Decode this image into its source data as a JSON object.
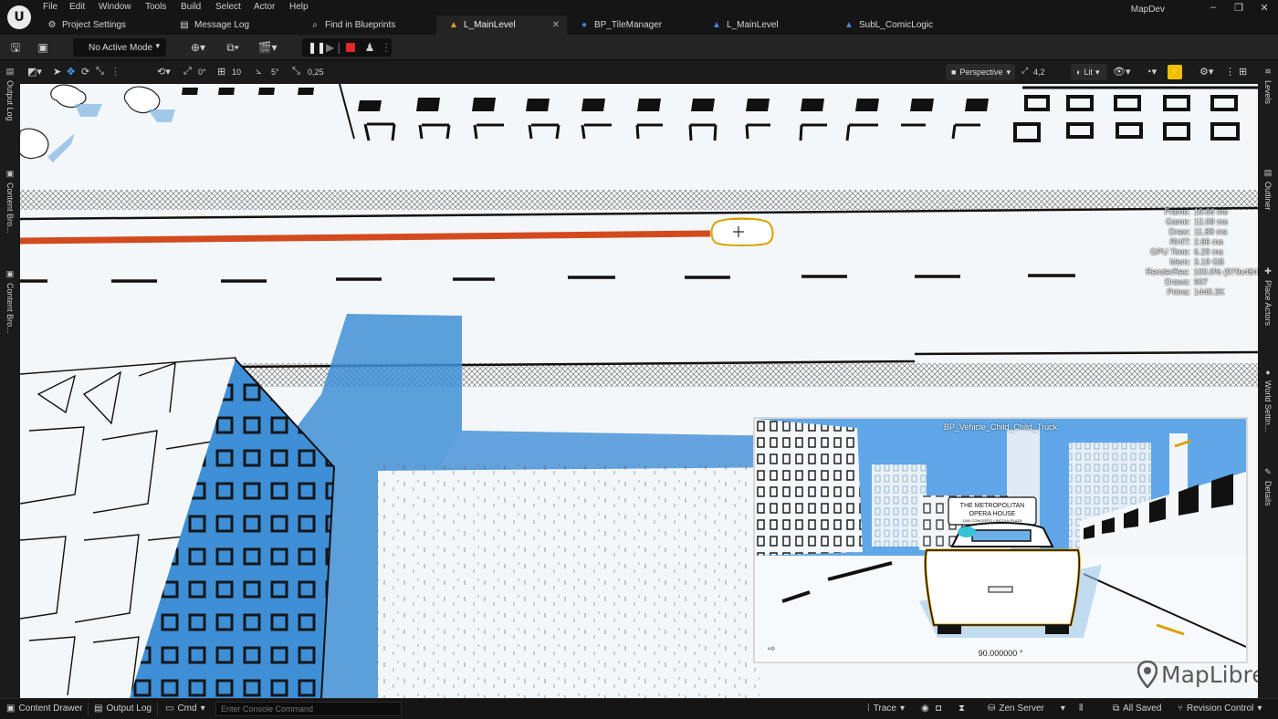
{
  "menu": {
    "logo": "U",
    "items": [
      "File",
      "Edit",
      "Window",
      "Tools",
      "Build",
      "Select",
      "Actor",
      "Help"
    ]
  },
  "tabs": [
    {
      "label": "Project Settings",
      "icon": "gear-icon"
    },
    {
      "label": "Message Log",
      "icon": "log-icon"
    },
    {
      "label": "Find in Blueprints",
      "icon": "search-icon"
    },
    {
      "label": "L_MainLevel",
      "icon": "level-icon",
      "active": true
    },
    {
      "label": "BP_TileManager",
      "icon": "blueprint-icon"
    },
    {
      "label": "L_MainLevel",
      "icon": "level-icon"
    },
    {
      "label": "SubL_ComicLogic",
      "icon": "level-icon"
    }
  ],
  "app_title": "MapDev",
  "window_controls": {
    "minimize": "–",
    "maximize": "❐",
    "close": "✕"
  },
  "toolbar": {
    "mode_label": "No Active Mode"
  },
  "viewport_toolbar": {
    "rotation_snap": "0°",
    "grid_snap": "10",
    "angle_snap": "5°",
    "scale_snap": "0,25",
    "view_mode": "Perspective",
    "fov": "4,2",
    "lighting": "Lit"
  },
  "left_panels": [
    "Output Log",
    "Content Bro...",
    "Content Bro..."
  ],
  "right_panels": [
    "Levels",
    "Outliner",
    "Place Actors",
    "World Settin...",
    "Details"
  ],
  "stats": [
    {
      "label": "Frame:",
      "value": "19.66 ms"
    },
    {
      "label": "Game:",
      "value": "12.09 ms"
    },
    {
      "label": "Draw:",
      "value": "11.88 ms"
    },
    {
      "label": "RHIT:",
      "value": "2.86 ms"
    },
    {
      "label": "GPU Time:",
      "value": "6.29 ms"
    },
    {
      "label": "Mem:",
      "value": "3.19 GB"
    },
    {
      "label": "RenderRes:",
      "value": "100.0% (979x484"
    },
    {
      "label": "Draws:",
      "value": "907"
    },
    {
      "label": "Prims:",
      "value": "1440.3K"
    }
  ],
  "pip": {
    "title": "BP_Vehicle_Child_Child_Truck",
    "angle": "90.000000 °",
    "sign_line1": "THE METROPOLITAN",
    "sign_line2": "OPERA HOUSE",
    "sign_line3": "1000 CONCERTO LINCOLN PLAZA"
  },
  "watermark": "MapLibre",
  "statusbar": {
    "content_drawer": "Content Drawer",
    "output_log": "Output Log",
    "cmd": "Cmd",
    "console_placeholder": "Enter Console Command",
    "trace": "Trace",
    "zen_server": "Zen Server",
    "all_saved": "All Saved",
    "revision_control": "Revision Control"
  },
  "colors": {
    "accent_yellow": "#f0c000",
    "path_red": "#d24a1e",
    "shadow_blue": "#3f8fd6",
    "sky_blue": "#5fa7e8"
  }
}
